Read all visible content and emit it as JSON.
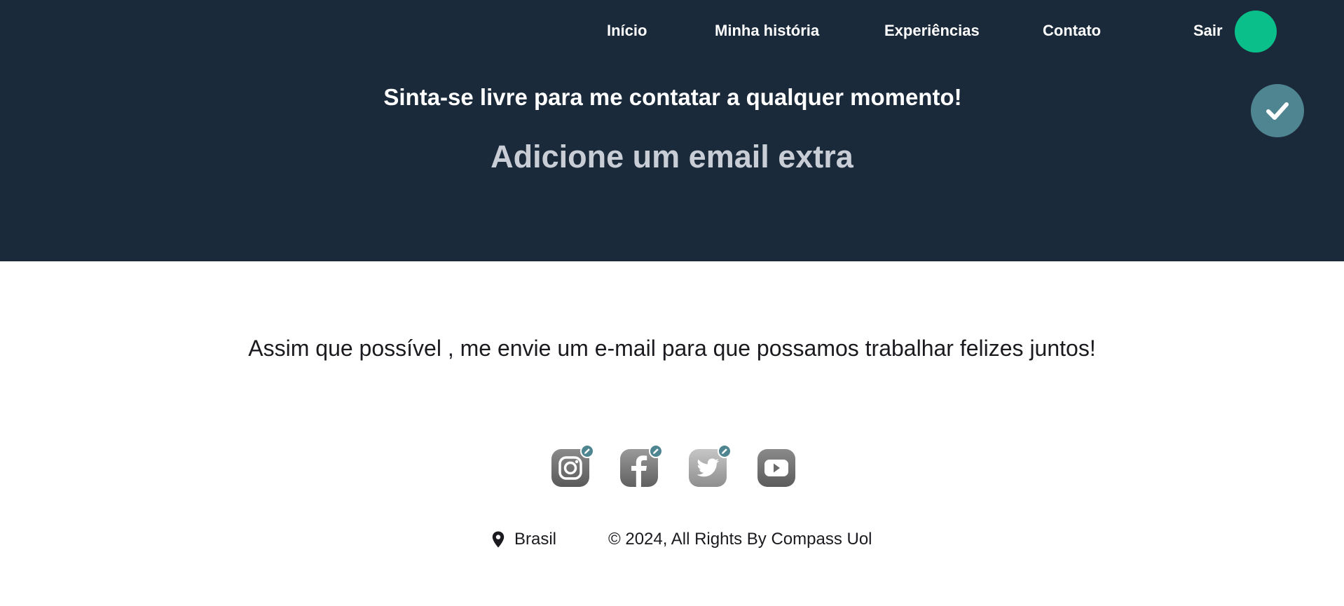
{
  "nav": {
    "items": [
      {
        "label": "Início"
      },
      {
        "label": "Minha história"
      },
      {
        "label": "Experiências"
      },
      {
        "label": "Contato"
      }
    ],
    "logout_label": "Sair",
    "avatar_color": "#0bbf8a"
  },
  "hero": {
    "background_color": "#1a2a3a",
    "headline": "Sinta-se livre para me contatar a qualquer momento!",
    "extra_email_label": "Adicione um email extra",
    "confirm_icon": "check-icon"
  },
  "main": {
    "message": "Assim que possível , me envie um e-mail para que possamos trabalhar felizes juntos!"
  },
  "social": {
    "links": [
      {
        "icon": "instagram-icon",
        "editable": true
      },
      {
        "icon": "facebook-icon",
        "editable": true
      },
      {
        "icon": "twitter-icon",
        "editable": true
      },
      {
        "icon": "youtube-icon",
        "editable": false
      }
    ],
    "edit_icon": "pencil-icon"
  },
  "footer": {
    "location_icon": "location-pin-icon",
    "location": "Brasil",
    "copyright": "© 2024, All Rights By Compass Uol"
  },
  "colors": {
    "accent": "#4f8590",
    "text_dark": "#1a1a1f",
    "muted_text": "#c9ced6"
  }
}
